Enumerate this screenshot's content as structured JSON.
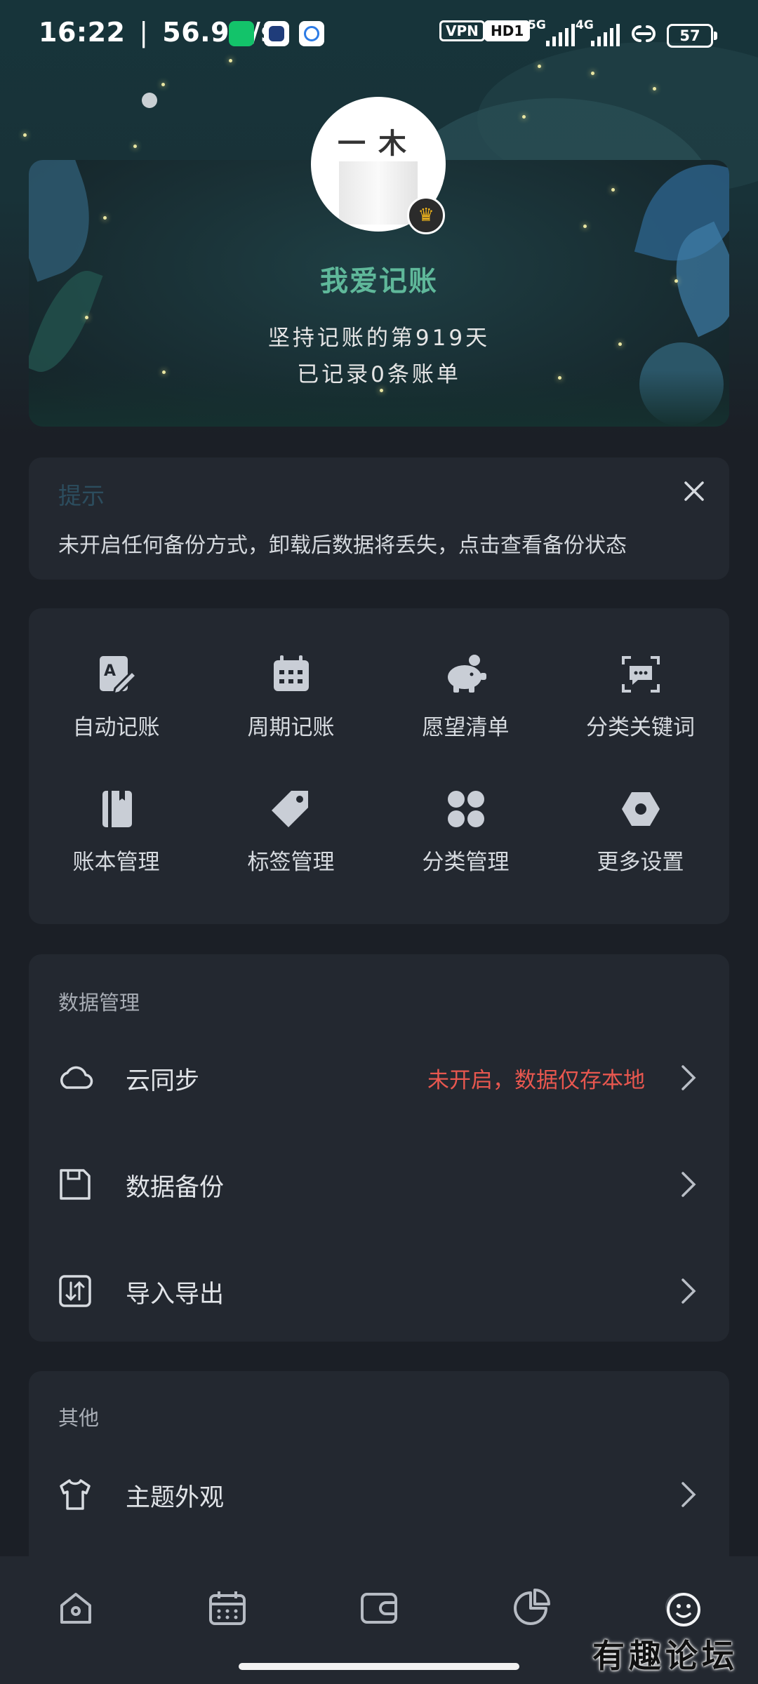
{
  "status_bar": {
    "time": "16:22",
    "speed": "56.9K/s",
    "vpn": "VPN",
    "hd": "HD1",
    "net1": "5G",
    "net2": "4G",
    "battery": "57"
  },
  "profile": {
    "avatar_text": "一木",
    "name": "我爱记账",
    "days_line": "坚持记账的第919天",
    "records_line": "已记录0条账单"
  },
  "tip": {
    "title": "提示",
    "message": "未开启任何备份方式，卸载后数据将丢失，点击查看备份状态"
  },
  "quick_actions": [
    {
      "label": "自动记账",
      "icon": "auto-bookkeeping-icon"
    },
    {
      "label": "周期记账",
      "icon": "calendar-icon"
    },
    {
      "label": "愿望清单",
      "icon": "piggy-bank-icon"
    },
    {
      "label": "分类关键词",
      "icon": "keyword-chat-icon"
    },
    {
      "label": "账本管理",
      "icon": "ledger-book-icon"
    },
    {
      "label": "标签管理",
      "icon": "tag-icon"
    },
    {
      "label": "分类管理",
      "icon": "category-grid-icon"
    },
    {
      "label": "更多设置",
      "icon": "settings-hex-icon"
    }
  ],
  "data_section": {
    "title": "数据管理",
    "items": [
      {
        "label": "云同步",
        "value": "未开启，数据仅存本地",
        "icon": "cloud-icon"
      },
      {
        "label": "数据备份",
        "value": "",
        "icon": "save-disk-icon"
      },
      {
        "label": "导入导出",
        "value": "",
        "icon": "import-export-icon"
      }
    ]
  },
  "other_section": {
    "title": "其他",
    "items": [
      {
        "label": "主题外观",
        "icon": "tshirt-icon"
      }
    ]
  },
  "bottom_nav": [
    "home-icon",
    "calendar-icon",
    "wallet-icon",
    "pie-chart-icon",
    "profile-smile-icon"
  ],
  "watermark": "有趣论坛",
  "colors": {
    "accent": "#5fb89a",
    "warning": "#e8574f",
    "card": "#232830",
    "background": "#1b1f26"
  }
}
